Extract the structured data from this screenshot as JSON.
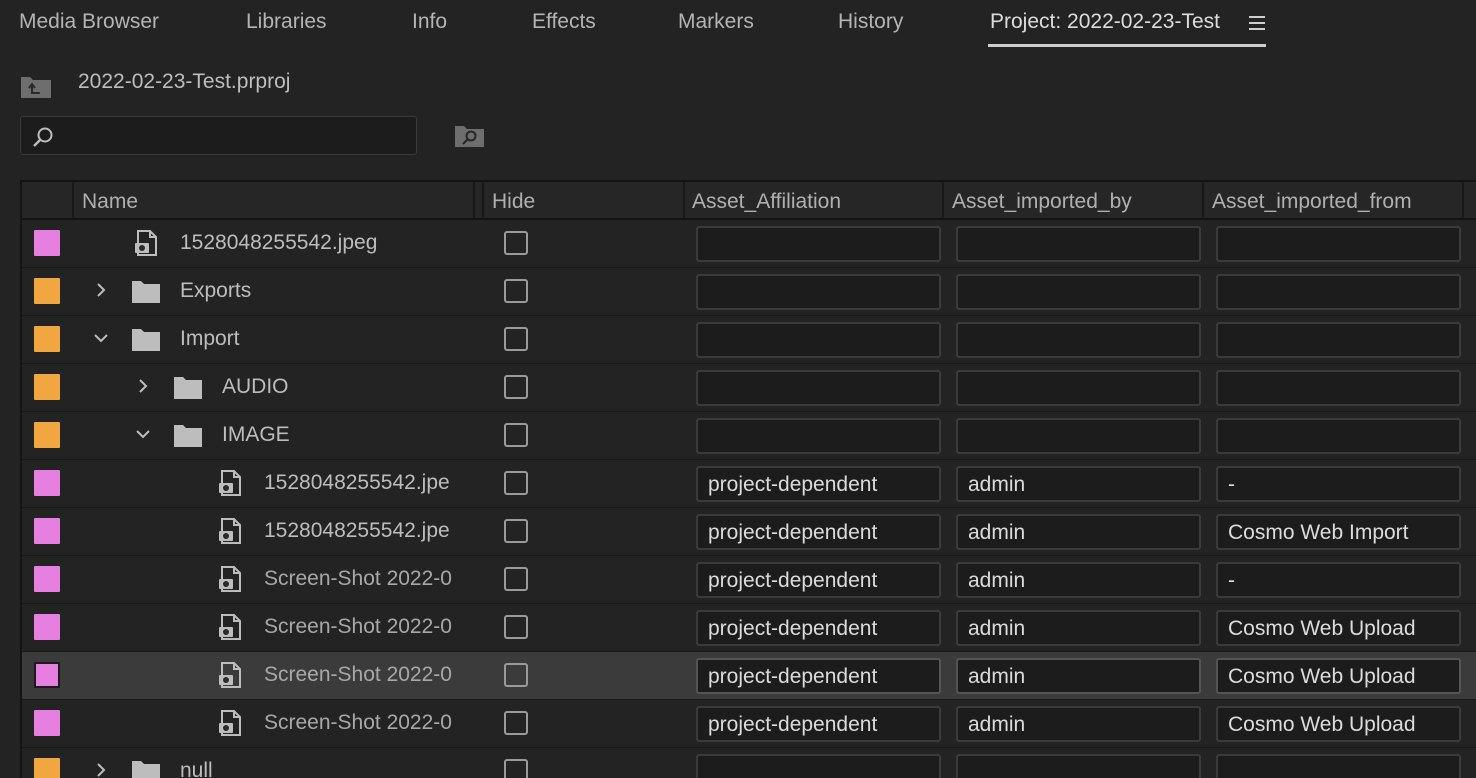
{
  "tabs": [
    {
      "label": "Media Browser"
    },
    {
      "label": "Libraries"
    },
    {
      "label": "Info"
    },
    {
      "label": "Effects"
    },
    {
      "label": "Markers"
    },
    {
      "label": "History"
    },
    {
      "label": "Project: 2022-02-23-Test"
    }
  ],
  "active_tab": "Project: 2022-02-23-Test",
  "project": {
    "file_name": "2022-02-23-Test.prproj"
  },
  "search": {
    "value": "",
    "placeholder": ""
  },
  "table": {
    "columns": {
      "name": "Name",
      "hide": "Hide",
      "affiliation": "Asset_Affiliation",
      "imported_by": "Asset_imported_by",
      "imported_from": "Asset_imported_from"
    },
    "rows": [
      {
        "name": "1528048255542.jpeg",
        "type": "image",
        "color": "#e77fe0",
        "affiliation": "",
        "imported_by": "",
        "imported_from": ""
      },
      {
        "name": "Exports",
        "type": "folder",
        "expanded": false,
        "color": "#f1a63f",
        "affiliation": "",
        "imported_by": "",
        "imported_from": ""
      },
      {
        "name": "Import",
        "type": "folder",
        "expanded": true,
        "color": "#f1a63f",
        "affiliation": "",
        "imported_by": "",
        "imported_from": ""
      },
      {
        "name": "AUDIO",
        "type": "folder",
        "expanded": false,
        "color": "#f1a63f",
        "affiliation": "",
        "imported_by": "",
        "imported_from": ""
      },
      {
        "name": "IMAGE",
        "type": "folder",
        "expanded": true,
        "color": "#f1a63f",
        "affiliation": "",
        "imported_by": "",
        "imported_from": ""
      },
      {
        "name": "1528048255542.jpe",
        "type": "image",
        "color": "#e77fe0",
        "affiliation": "project-dependent",
        "imported_by": "admin",
        "imported_from": "-"
      },
      {
        "name": "1528048255542.jpe",
        "type": "image",
        "color": "#e77fe0",
        "affiliation": "project-dependent",
        "imported_by": "admin",
        "imported_from": "Cosmo Web Import"
      },
      {
        "name": "Screen-Shot 2022-0",
        "type": "image",
        "color": "#e77fe0",
        "affiliation": "project-dependent",
        "imported_by": "admin",
        "imported_from": "-"
      },
      {
        "name": "Screen-Shot 2022-0",
        "type": "image",
        "color": "#e77fe0",
        "affiliation": "project-dependent",
        "imported_by": "admin",
        "imported_from": "Cosmo Web Upload"
      },
      {
        "name": "Screen-Shot 2022-0",
        "type": "image",
        "color": "#e77fe0",
        "affiliation": "project-dependent",
        "imported_by": "admin",
        "imported_from": "Cosmo Web Upload",
        "selected": true
      },
      {
        "name": "Screen-Shot 2022-0",
        "type": "image",
        "color": "#e77fe0",
        "affiliation": "project-dependent",
        "imported_by": "admin",
        "imported_from": "Cosmo Web Upload"
      },
      {
        "name": "null",
        "type": "folder",
        "expanded": false,
        "color": "#f1a63f",
        "affiliation": "",
        "imported_by": "",
        "imported_from": ""
      }
    ]
  }
}
